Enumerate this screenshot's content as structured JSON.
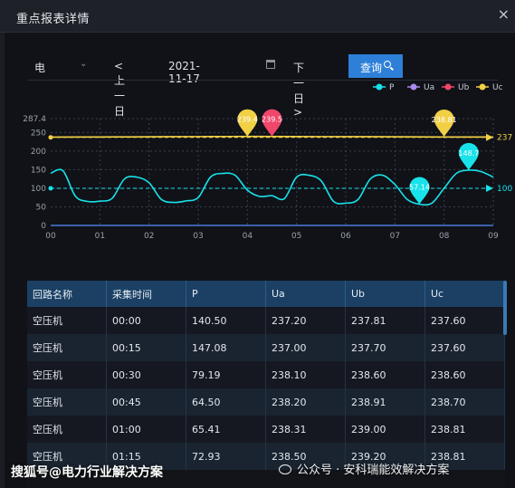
{
  "window": {
    "title": "重点报表详情",
    "close_icon": "×"
  },
  "controls": {
    "meter_select": "电",
    "prev_label": "< 上一日",
    "date": "2021-11-17",
    "next_label": "下一日 >",
    "query_label": "查询"
  },
  "chart_data": {
    "type": "line",
    "legend": [
      "P",
      "Ua",
      "Ub",
      "Uc"
    ],
    "colors": {
      "P": "#18e2ea",
      "Ua": "#a88af0",
      "Ub": "#f0466a",
      "Uc": "#f2d046"
    },
    "x_ticks": [
      "00",
      "01",
      "02",
      "03",
      "04",
      "05",
      "06",
      "07",
      "08",
      "09"
    ],
    "y_ticks": [
      "0",
      "50",
      "100",
      "150",
      "200",
      "250",
      "287.4"
    ],
    "ylim": [
      0,
      287.4
    ],
    "xlim": [
      0,
      9
    ],
    "series": [
      {
        "name": "P",
        "x": [
          0,
          0.25,
          0.5,
          0.75,
          1,
          1.25,
          1.5,
          1.75,
          2,
          2.25,
          2.5,
          2.75,
          3,
          3.25,
          3.5,
          3.75,
          4,
          4.25,
          4.5,
          4.75,
          5,
          5.25,
          5.5,
          5.75,
          6,
          6.25,
          6.5,
          6.75,
          7,
          7.25,
          7.5,
          7.75,
          8,
          8.25,
          8.5,
          8.75,
          9
        ],
        "values": [
          140.5,
          147.08,
          79.19,
          64.5,
          65.41,
          72.93,
          125,
          130,
          115,
          70,
          62,
          66,
          75,
          130,
          140,
          135,
          95,
          78,
          80,
          72,
          130,
          135,
          120,
          65,
          60,
          70,
          125,
          135,
          110,
          70,
          57.14,
          60,
          100,
          140,
          148.7,
          145,
          130
        ]
      },
      {
        "name": "Uc",
        "x": [
          0,
          1,
          2,
          3,
          4,
          5,
          6,
          7,
          8,
          9
        ],
        "values": [
          237.6,
          238,
          238.5,
          239,
          239.4,
          239.2,
          238.8,
          238.6,
          238,
          237.9
        ]
      }
    ],
    "markpoints": [
      {
        "series": "Uc",
        "label": "239.4",
        "x": 4.0,
        "y": 239.4
      },
      {
        "series": "Ub",
        "label": "239.5",
        "x": 4.5,
        "y": 239.5
      },
      {
        "series": "Uc",
        "label": "238.81",
        "x": 8.0,
        "y": 238.81
      },
      {
        "series": "P",
        "label": "148.7",
        "x": 8.5,
        "y": 148.7
      },
      {
        "series": "P",
        "label": "57.14",
        "x": 7.5,
        "y": 57.14
      }
    ],
    "marklines": [
      {
        "series": "Uc",
        "value": 237,
        "end_label": "237"
      },
      {
        "series": "P",
        "value": 100,
        "end_label": "100"
      }
    ]
  },
  "table": {
    "columns": [
      "回路名称",
      "采集时间",
      "P",
      "Ua",
      "Ub",
      "Uc"
    ],
    "rows": [
      [
        "空压机",
        "00:00",
        "140.50",
        "237.20",
        "237.81",
        "237.60"
      ],
      [
        "空压机",
        "00:15",
        "147.08",
        "237.00",
        "237.70",
        "237.60"
      ],
      [
        "空压机",
        "00:30",
        "79.19",
        "238.10",
        "238.60",
        "238.60"
      ],
      [
        "空压机",
        "00:45",
        "64.50",
        "238.20",
        "238.91",
        "238.70"
      ],
      [
        "空压机",
        "01:00",
        "65.41",
        "238.31",
        "239.00",
        "238.81"
      ],
      [
        "空压机",
        "01:15",
        "72.93",
        "238.50",
        "239.20",
        "238.81"
      ]
    ]
  },
  "watermarks": {
    "left": "搜狐号@电力行业解决方案",
    "right": "公众号 · 安科瑞能效解决方案"
  }
}
